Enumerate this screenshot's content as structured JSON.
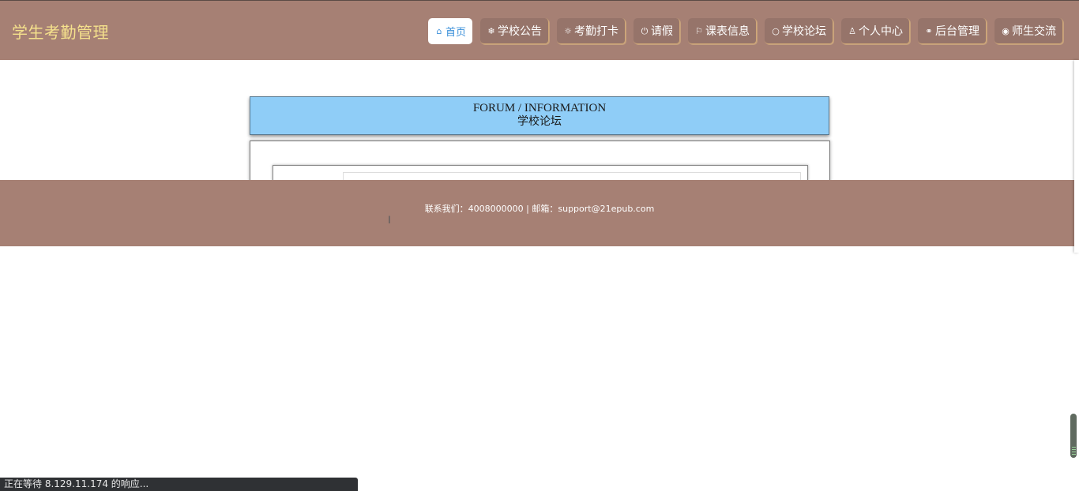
{
  "header": {
    "brand": "学生考勤管理",
    "nav": [
      {
        "icon": "home-icon",
        "glyph": "⌂",
        "label": "首页",
        "active": true
      },
      {
        "icon": "snowflake-icon",
        "glyph": "❄",
        "label": "学校公告",
        "active": false
      },
      {
        "icon": "sun-icon",
        "glyph": "☼",
        "label": "考勤打卡",
        "active": false
      },
      {
        "icon": "power-icon",
        "glyph": "⏻",
        "label": "请假",
        "active": false
      },
      {
        "icon": "flag-icon",
        "glyph": "⚐",
        "label": "课表信息",
        "active": false
      },
      {
        "icon": "circle-icon",
        "glyph": "○",
        "label": "学校论坛",
        "active": false
      },
      {
        "icon": "user-icon",
        "glyph": "♙",
        "label": "个人中心",
        "active": false
      },
      {
        "icon": "link-icon",
        "glyph": "⚭",
        "label": "后台管理",
        "active": false
      },
      {
        "icon": "chat-icon",
        "glyph": "◉",
        "label": "师生交流",
        "active": false
      }
    ]
  },
  "forum": {
    "title_en": "FORUM / INFORMATION",
    "title_cn": "学校论坛"
  },
  "footer": {
    "contact": "联系我们：4008000000 | 邮箱：support@21epub.com"
  },
  "status_bar": {
    "text": "正在等待 8.129.11.174 的响应..."
  }
}
